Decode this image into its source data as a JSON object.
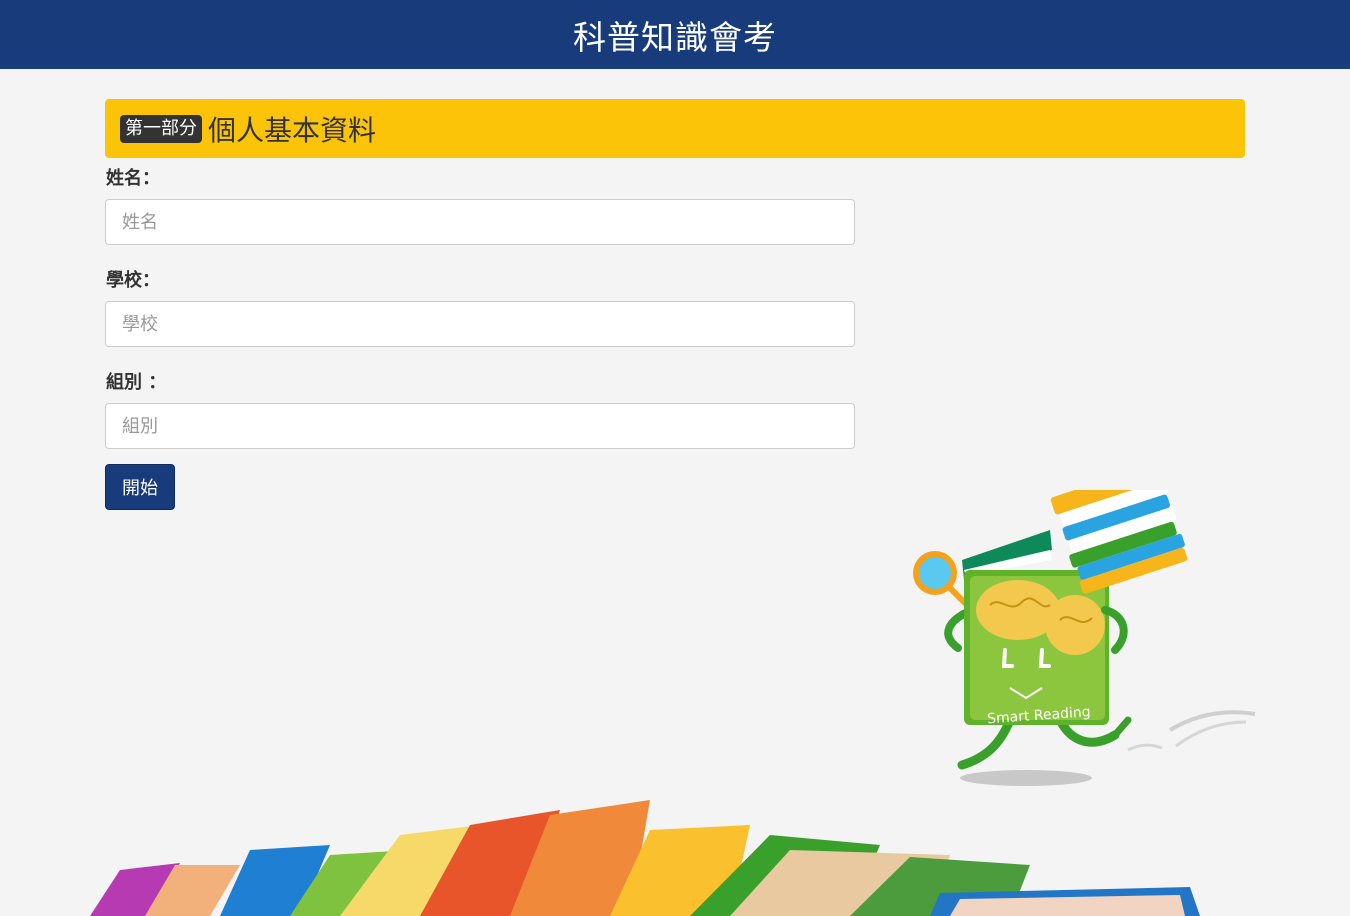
{
  "header": {
    "title": "科普知識會考"
  },
  "section": {
    "part_badge": "第一部分",
    "title": "個人基本資料"
  },
  "form": {
    "name": {
      "label": "姓名：",
      "placeholder": "姓名",
      "value": ""
    },
    "school": {
      "label": "學校：",
      "placeholder": "學校",
      "value": ""
    },
    "group": {
      "label": "組別 ：",
      "placeholder": "組別",
      "value": ""
    },
    "start_label": "開始"
  },
  "mascot": {
    "caption": "Smart Reading"
  },
  "colors": {
    "header_bg": "#183c7b",
    "banner_bg": "#fcc409",
    "button_bg": "#183c7b",
    "page_bg": "#f4f4f4"
  }
}
